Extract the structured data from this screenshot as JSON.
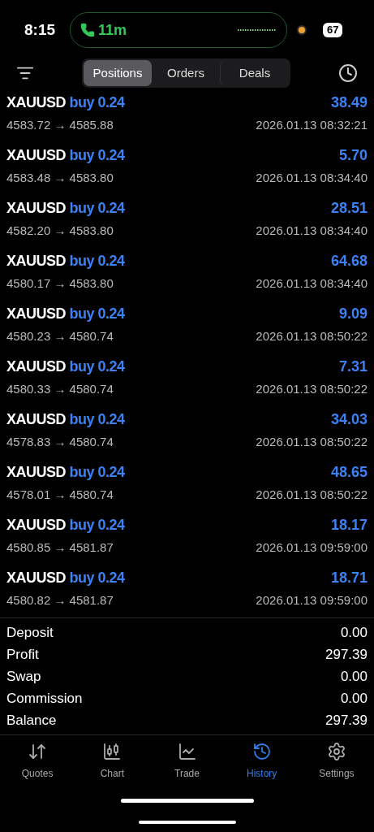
{
  "status_bar": {
    "time": "8:15",
    "call_duration": "11m",
    "battery": "67"
  },
  "tabs": [
    {
      "label": "Positions",
      "selected": true
    },
    {
      "label": "Orders",
      "selected": false
    },
    {
      "label": "Deals",
      "selected": false
    }
  ],
  "deals": [
    {
      "symbol": "XAUUSD",
      "side": "buy 0.24",
      "profit": "38.49",
      "prices": "4583.72 → 4585.88",
      "time": "2026.01.13 08:32:21"
    },
    {
      "symbol": "XAUUSD",
      "side": "buy 0.24",
      "profit": "5.70",
      "prices": "4583.48 → 4583.80",
      "time": "2026.01.13 08:34:40"
    },
    {
      "symbol": "XAUUSD",
      "side": "buy 0.24",
      "profit": "28.51",
      "prices": "4582.20 → 4583.80",
      "time": "2026.01.13 08:34:40"
    },
    {
      "symbol": "XAUUSD",
      "side": "buy 0.24",
      "profit": "64.68",
      "prices": "4580.17 → 4583.80",
      "time": "2026.01.13 08:34:40"
    },
    {
      "symbol": "XAUUSD",
      "side": "buy 0.24",
      "profit": "9.09",
      "prices": "4580.23 → 4580.74",
      "time": "2026.01.13 08:50:22"
    },
    {
      "symbol": "XAUUSD",
      "side": "buy 0.24",
      "profit": "7.31",
      "prices": "4580.33 → 4580.74",
      "time": "2026.01.13 08:50:22"
    },
    {
      "symbol": "XAUUSD",
      "side": "buy 0.24",
      "profit": "34.03",
      "prices": "4578.83 → 4580.74",
      "time": "2026.01.13 08:50:22"
    },
    {
      "symbol": "XAUUSD",
      "side": "buy 0.24",
      "profit": "48.65",
      "prices": "4578.01 → 4580.74",
      "time": "2026.01.13 08:50:22"
    },
    {
      "symbol": "XAUUSD",
      "side": "buy 0.24",
      "profit": "18.17",
      "prices": "4580.85 → 4581.87",
      "time": "2026.01.13 09:59:00"
    },
    {
      "symbol": "XAUUSD",
      "side": "buy 0.24",
      "profit": "18.71",
      "prices": "4580.82 → 4581.87",
      "time": "2026.01.13 09:59:00"
    }
  ],
  "summary": [
    {
      "label": "Deposit",
      "value": "0.00"
    },
    {
      "label": "Profit",
      "value": "297.39"
    },
    {
      "label": "Swap",
      "value": "0.00"
    },
    {
      "label": "Commission",
      "value": "0.00"
    },
    {
      "label": "Balance",
      "value": "297.39"
    }
  ],
  "nav": [
    {
      "kind": "quotes",
      "label": "Quotes",
      "selected": false
    },
    {
      "kind": "chart",
      "label": "Chart",
      "selected": false
    },
    {
      "kind": "trade",
      "label": "Trade",
      "selected": false
    },
    {
      "kind": "history",
      "label": "History",
      "selected": true
    },
    {
      "kind": "settings",
      "label": "Settings",
      "selected": false
    }
  ]
}
